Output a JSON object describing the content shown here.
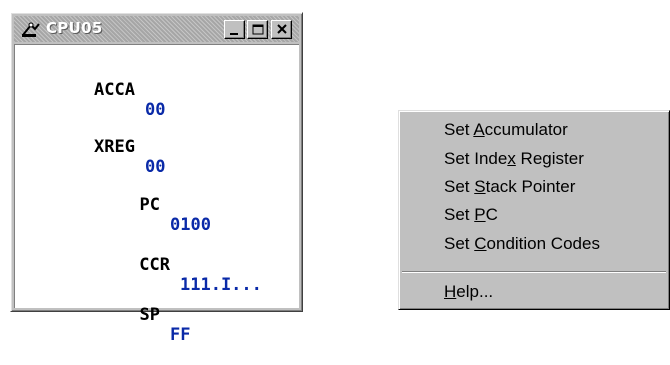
{
  "window": {
    "title": "CPU05",
    "registers": [
      {
        "label": "ACCA",
        "value": "00"
      },
      {
        "label": "XREG",
        "value": "00"
      },
      {
        "label": "PC",
        "value": "0100"
      },
      {
        "label": "CCR",
        "value": "111.I..."
      },
      {
        "label": "SP",
        "value": "FF"
      }
    ]
  },
  "context_menu": {
    "items": [
      {
        "pre": "Set ",
        "key": "A",
        "post": "ccumulator"
      },
      {
        "pre": "Set Inde",
        "key": "x",
        "post": " Register"
      },
      {
        "pre": "Set ",
        "key": "S",
        "post": "tack Pointer"
      },
      {
        "pre": "Set ",
        "key": "P",
        "post": "C"
      },
      {
        "pre": "Set ",
        "key": "C",
        "post": "ondition Codes"
      },
      {
        "pre": "",
        "key": "H",
        "post": "elp..."
      }
    ]
  }
}
